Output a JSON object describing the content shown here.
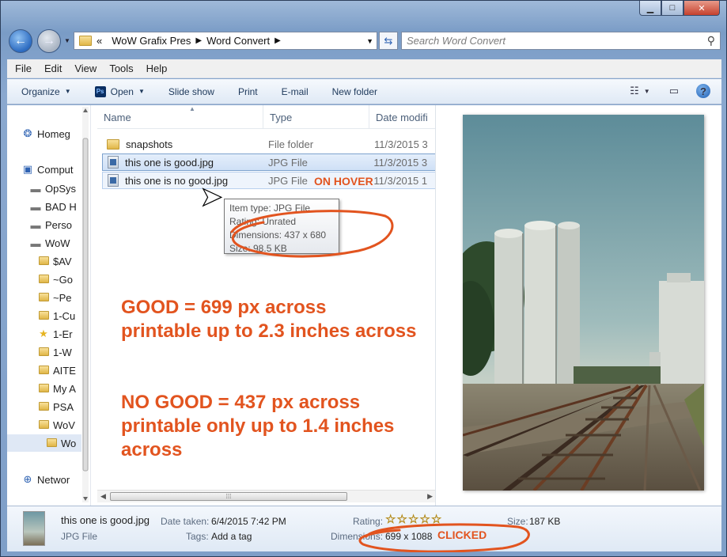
{
  "window": {
    "controls": {
      "minimize": "▁",
      "maximize": "□",
      "close": "✕"
    }
  },
  "address": {
    "overflow": "«",
    "crumbs": [
      "WoW Grafix Pres",
      "Word Convert"
    ],
    "search_placeholder": "Search Word Convert"
  },
  "menu": [
    "File",
    "Edit",
    "View",
    "Tools",
    "Help"
  ],
  "commands": {
    "organize": "Organize",
    "open": "Open",
    "ps_badge": "Ps",
    "slideshow": "Slide show",
    "print": "Print",
    "email": "E-mail",
    "new_folder": "New folder"
  },
  "sidebar": {
    "items": [
      {
        "label": "Homeg",
        "icon": "homegroup-icon"
      },
      {
        "label": "Comput",
        "icon": "computer-icon"
      },
      {
        "label": "OpSys",
        "icon": "drive-icon"
      },
      {
        "label": "BAD H",
        "icon": "drive-icon"
      },
      {
        "label": "Perso",
        "icon": "drive-icon"
      },
      {
        "label": "WoW",
        "icon": "drive-icon"
      },
      {
        "label": "$AV",
        "icon": "folder-icon"
      },
      {
        "label": "~Go",
        "icon": "folder-icon"
      },
      {
        "label": "~Pe",
        "icon": "folder-icon"
      },
      {
        "label": "1-Cu",
        "icon": "folder-icon"
      },
      {
        "label": "1-Er",
        "icon": "star-icon"
      },
      {
        "label": "1-W",
        "icon": "folder-icon"
      },
      {
        "label": "AITE",
        "icon": "folder-icon"
      },
      {
        "label": "My A",
        "icon": "folder-icon"
      },
      {
        "label": "PSA",
        "icon": "folder-icon"
      },
      {
        "label": "WoV",
        "icon": "folder-icon"
      },
      {
        "label": "Wo",
        "icon": "folder-icon"
      },
      {
        "label": "Networ",
        "icon": "network-icon"
      }
    ]
  },
  "columns": {
    "name": "Name",
    "type": "Type",
    "date": "Date modifi"
  },
  "files": [
    {
      "name": "snapshots",
      "type": "File folder",
      "date": "11/3/2015 3",
      "kind": "folder"
    },
    {
      "name": "this one is good.jpg",
      "type": "JPG File",
      "date": "11/3/2015 3",
      "kind": "jpg",
      "state": "selected"
    },
    {
      "name": "this one is no good.jpg",
      "type": "JPG File",
      "date": "11/3/2015 1",
      "kind": "jpg",
      "state": "hover"
    }
  ],
  "hover_label": "ON HOVER",
  "tooltip": {
    "lines": [
      "Item type: JPG File",
      "Rating: Unrated",
      "Dimensions: 437 x 680",
      "Size: 98.5 KB"
    ]
  },
  "notes": {
    "good": "GOOD = 699 px across\nprintable up to 2.3 inches across",
    "bad": "NO GOOD = 437 px across\nprintable only up to 1.4 inches\nacross"
  },
  "details": {
    "filename": "this one is good.jpg",
    "filetype": "JPG File",
    "date_taken_label": "Date taken:",
    "date_taken": "6/4/2015 7:42 PM",
    "tags_label": "Tags:",
    "tags": "Add a tag",
    "rating_label": "Rating:",
    "rating_stars": 0,
    "dimensions_label": "Dimensions:",
    "dimensions": "699 x 1088",
    "size_label": "Size:",
    "size": "187 KB",
    "clicked_label": "CLICKED"
  },
  "colors": {
    "annotation": "#e2541f",
    "selection": "#cfe0f6",
    "accent_blue": "#2c6bc1"
  }
}
